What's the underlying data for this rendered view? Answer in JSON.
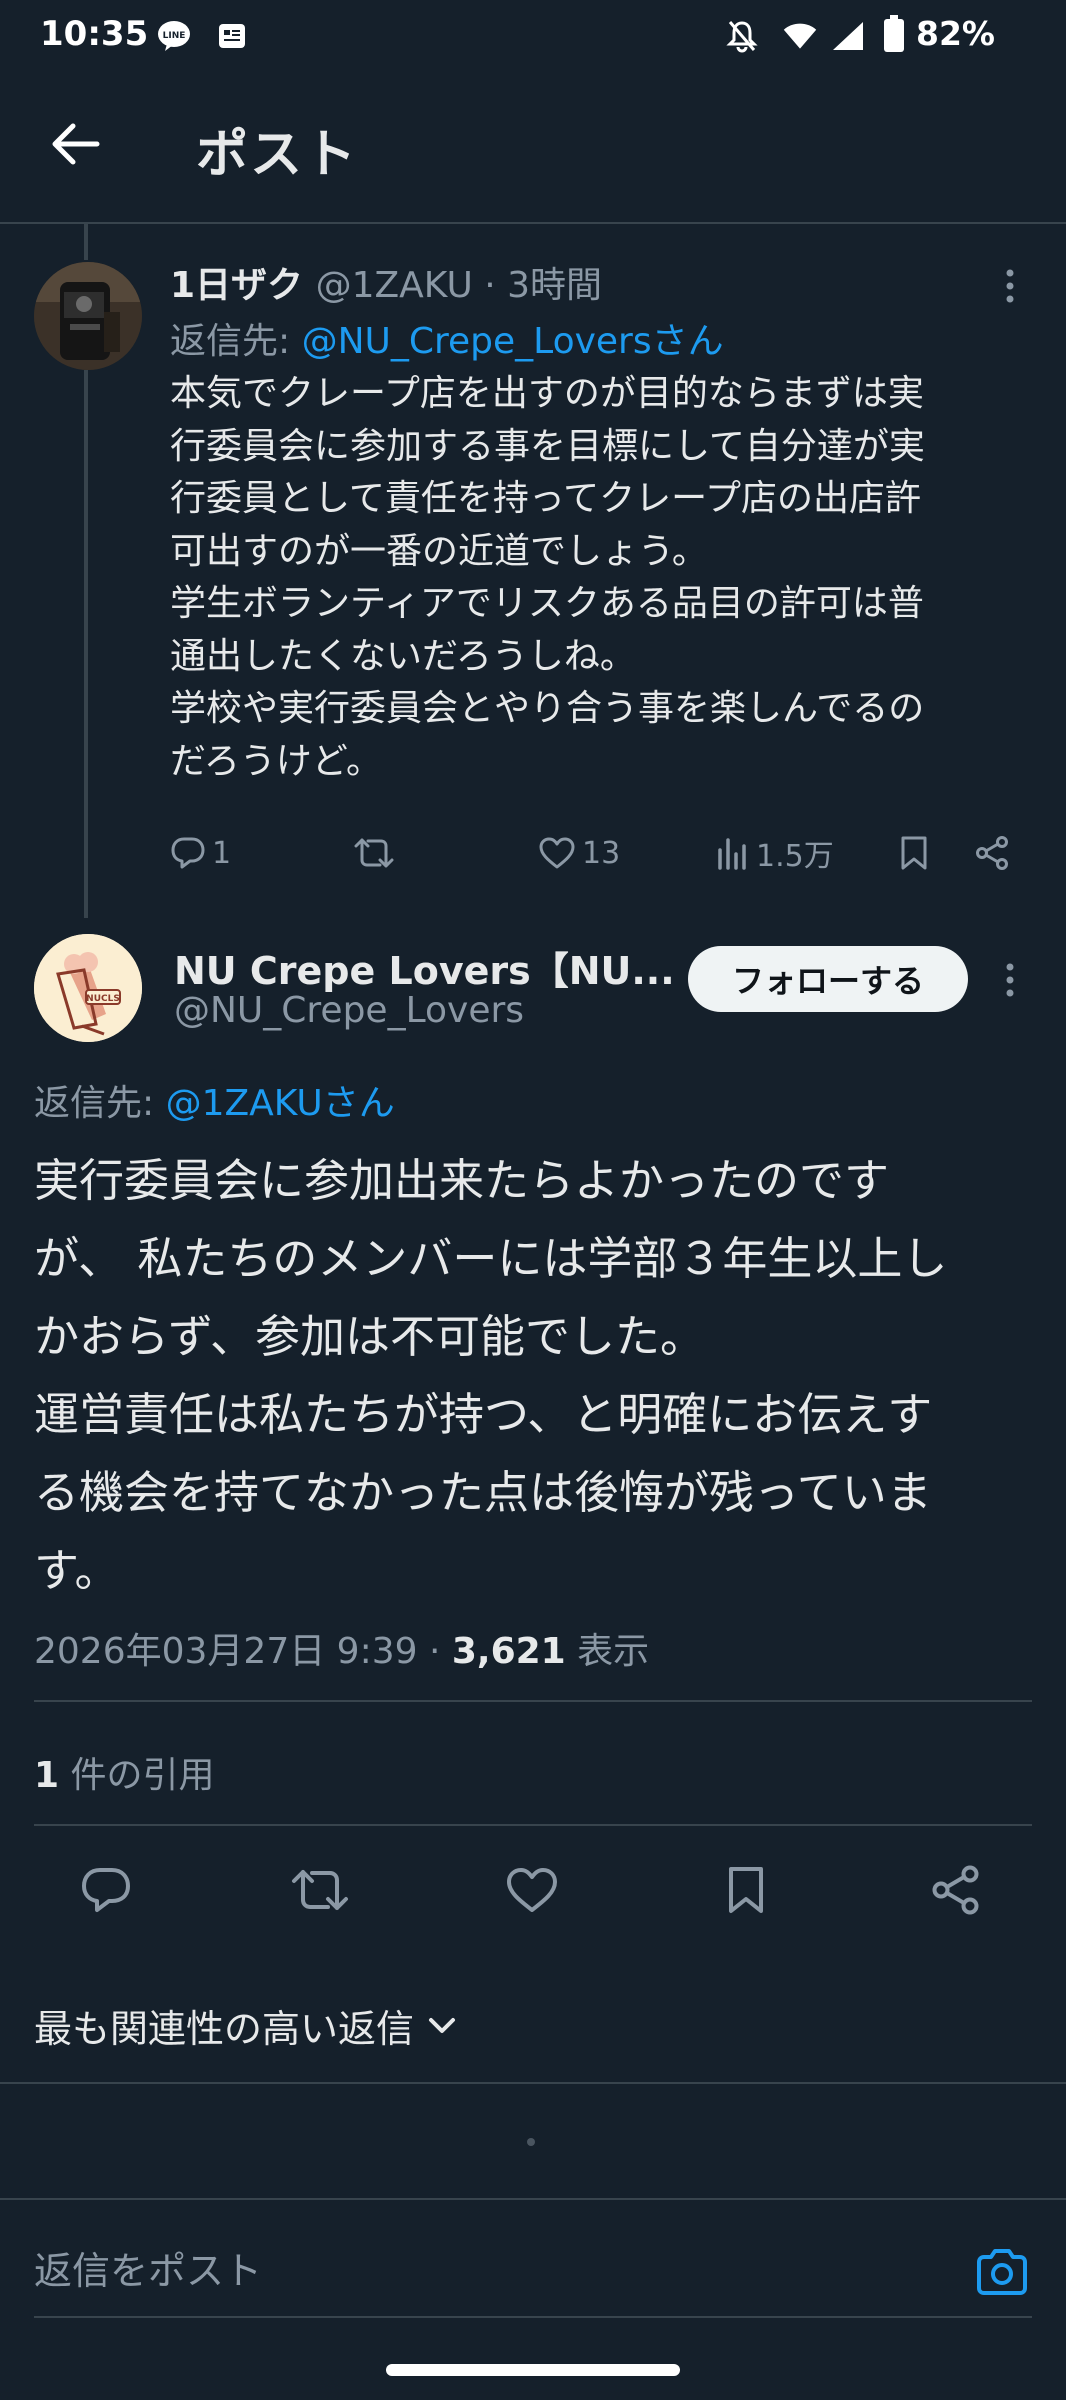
{
  "status_bar": {
    "time": "10:35",
    "battery": "82%"
  },
  "header": {
    "title": "ポスト"
  },
  "reply_tweet": {
    "name": "1日ザク",
    "handle": "@1ZAKU · 3時間",
    "reply_to_prefix": "返信先: ",
    "reply_to_link": "@NU_Crepe_Loversさん",
    "body": "本気でクレープ店を出すのが目的ならまずは実\n行委員会に参加する事を目標にして自分達が実\n行委員として責任を持ってクレープ店の出店許\n可出すのが一番の近道でしょう。\n学生ボランティアでリスクある品目の許可は普\n通出したくないだろうしね。\n学校や実行委員会とやり合う事を楽しんでるの\nだろうけど。",
    "replies": "1",
    "likes": "13",
    "views": "1.5万"
  },
  "main_tweet": {
    "name": "NU Crepe Lovers【NU...",
    "handle": "@NU_Crepe_Lovers",
    "follow_label": "フォローする",
    "avatar_text": "NUCLS",
    "reply_to_prefix": "返信先: ",
    "reply_to_link": "@1ZAKUさん",
    "body": "実行委員会に参加出来たらよかったのです\nが、 私たちのメンバーには学部３年生以上し\nかおらず、参加は不可能でした。\n運営責任は私たちが持つ、と明確にお伝えす\nる機会を持てなかった点は後悔が残っていま\nす。",
    "datetime": "2026年03月27日 9:39 · ",
    "view_count": "3,621",
    "view_label": " 表示",
    "quote_count": "1",
    "quote_label": " 件の引用"
  },
  "sort_label": "最も関連性の高い返信",
  "compose_placeholder": "返信をポスト",
  "colors": {
    "background": "#15202b",
    "accent": "#1d9bf0",
    "secondary_text": "#8b98a5",
    "divider": "#38444d"
  }
}
